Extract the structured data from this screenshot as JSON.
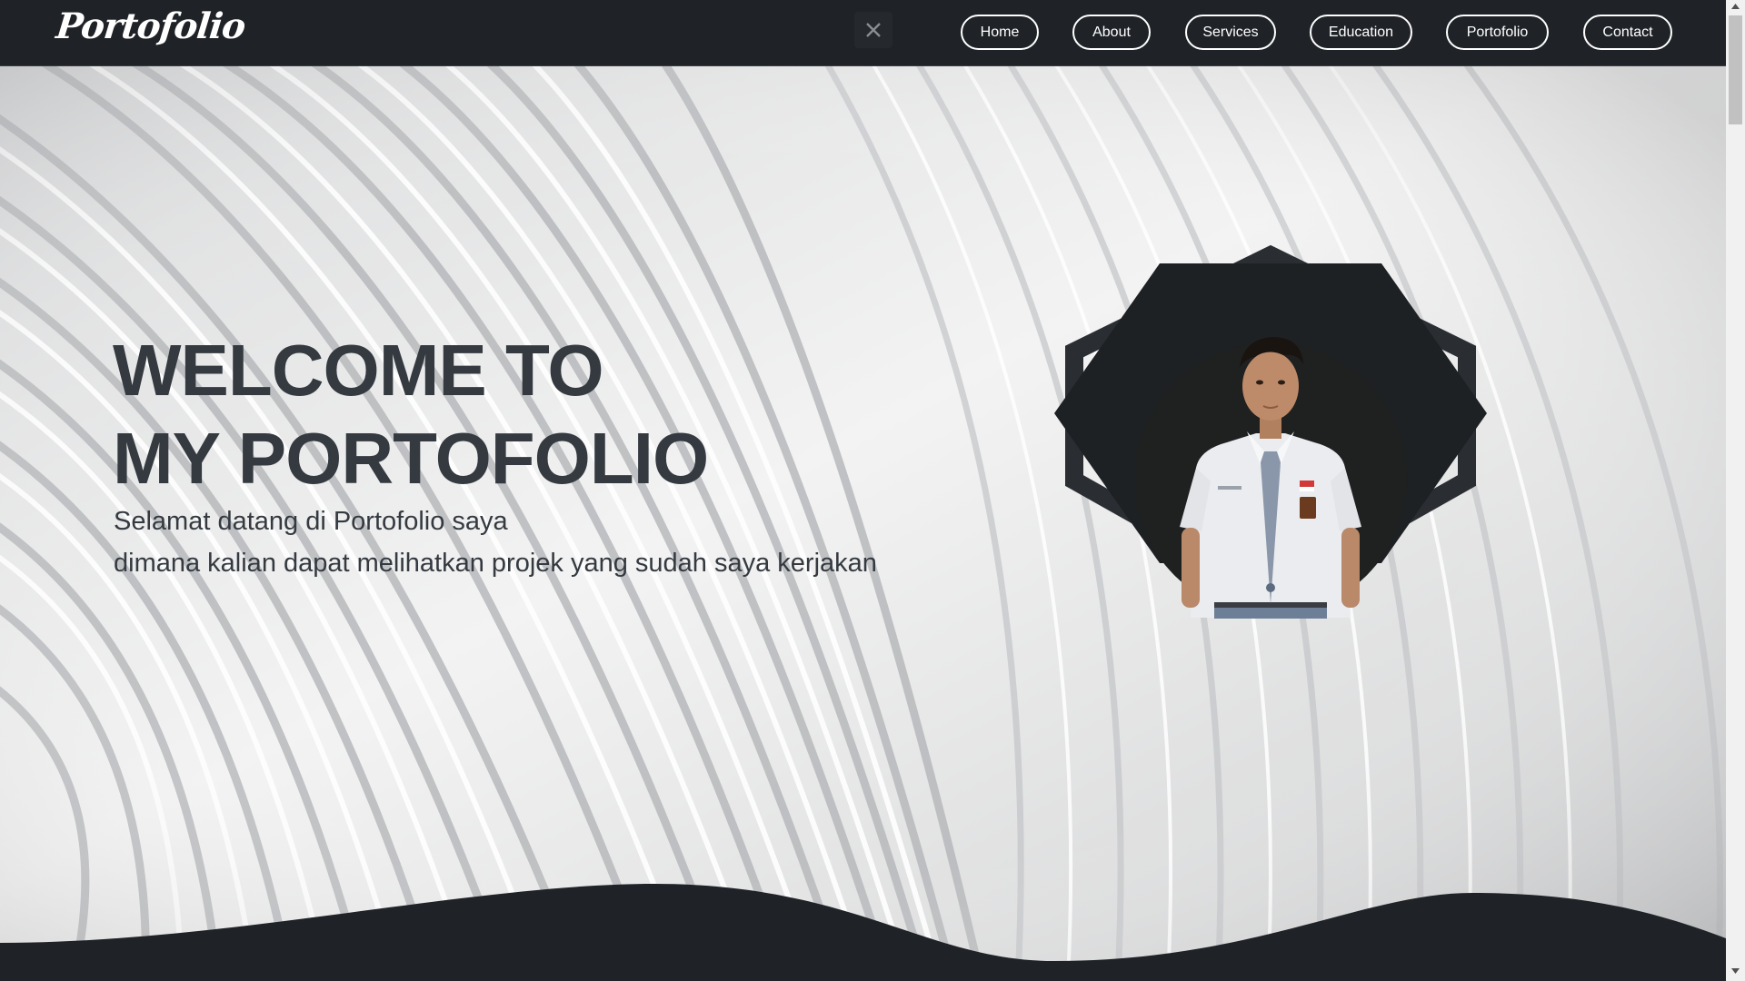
{
  "brand": {
    "logo_text": "Portofolio"
  },
  "nav": {
    "items": [
      {
        "label": "Home"
      },
      {
        "label": "About"
      },
      {
        "label": "Services"
      },
      {
        "label": "Education"
      },
      {
        "label": "Portofolio"
      },
      {
        "label": "Contact"
      }
    ],
    "close_icon": "close-icon"
  },
  "hero": {
    "title_line1": "WELCOME TO",
    "title_line2": "MY PORTOFOLIO",
    "subtitle_line1": "Selamat datang di Portofolio saya",
    "subtitle_line2": "dimana kalian dapat melihatkan projek yang sudah saya kerjakan",
    "background": "curved-white-architecture-photo",
    "profile_image": "student-portrait-photo"
  },
  "colors": {
    "navbar_bg": "#1f2227",
    "text_dark": "#343a40",
    "nav_text": "#ffffff",
    "wave": "#1f2227"
  }
}
